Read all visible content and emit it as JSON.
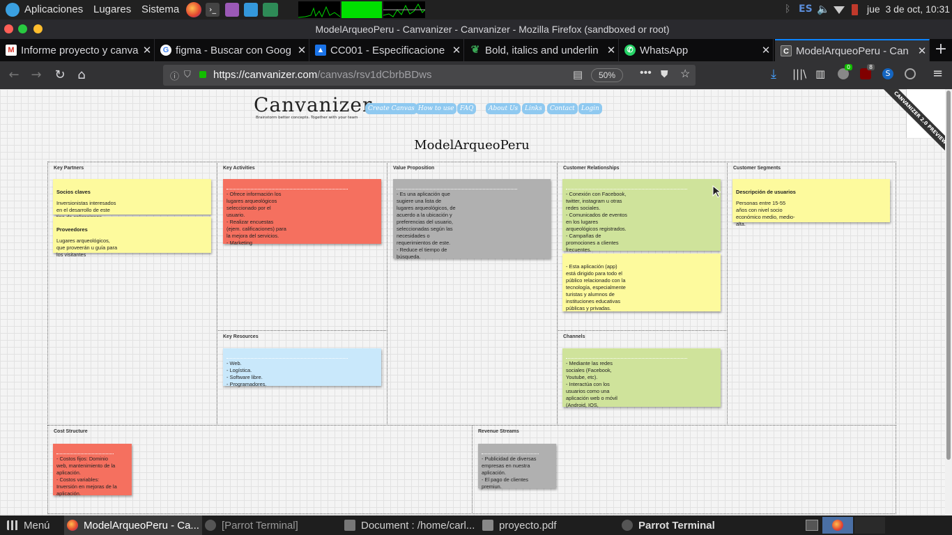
{
  "system_panel": {
    "apps_label": "Aplicaciones",
    "places_label": "Lugares",
    "system_label": "Sistema",
    "keyboard_layout": "ES",
    "datetime": "jue  3 de oct, 10:31"
  },
  "window": {
    "title": "ModelArqueoPeru - Canvanizer - Canvanizer - Mozilla Firefox (sandboxed or root)"
  },
  "tabs": [
    {
      "label": "Informe proyecto y canva",
      "icon": "gmail-icon",
      "color": "#d93025"
    },
    {
      "label": "figma - Buscar con Goog",
      "icon": "google-icon",
      "color": "#4285f4"
    },
    {
      "label": "CC001 - Especificacione",
      "icon": "docs-user-icon",
      "color": "#1a73e8"
    },
    {
      "label": "Bold, italics and underlin",
      "icon": "leaf-icon",
      "color": "#3aa655"
    },
    {
      "label": "WhatsApp",
      "icon": "whatsapp-icon",
      "color": "#25d366"
    },
    {
      "label": "ModelArqueoPeru - Can",
      "icon": "canvanizer-icon",
      "color": "#777777",
      "active": true
    }
  ],
  "navbar": {
    "url_host": "https://canvanizer.com",
    "url_path": "/canvas/rsv1dCbrbBDws",
    "zoom": "50%",
    "ublock_badge": "8",
    "addon_badge": "0"
  },
  "canvanizer": {
    "logo": "Canvanizer",
    "tagline": "Brainstorm better concepts. Together with your team",
    "nav": [
      "Create Canvas",
      "How to use",
      "FAQ",
      "About Us",
      "Links",
      "Contact",
      "Login"
    ],
    "preview_ribbon": "CANVANIZER 2.0 PREVIEW",
    "canvas_title": "ModelArqueoPeru",
    "cells": {
      "key_partners": "Key Partners",
      "key_activities": "Key Activities",
      "value_proposition": "Value Proposition",
      "customer_relationships": "Customer Relationships",
      "customer_segments": "Customer Segments",
      "key_resources": "Key Resources",
      "channels": "Channels",
      "cost_structure": "Cost Structure",
      "revenue_streams": "Revenue Streams"
    },
    "notes": {
      "kp1_title": "Socios claves",
      "kp1_body": "Inversionistas interesados\nen el desarrollo de este\ntipo de aplicaciones.",
      "kp2_title": "Proveedores",
      "kp2_body": "Lugares arqueológicos,\nque proveerán u guía para\nlos visitantes",
      "ka1_body": "- Ofrece información los\nlugares arqueológicos\nseleccionado por el\nusuario.\n- Realizar encuestas\n(ejem. calificaciones) para\nla mejora del servicios.\n- Marketing",
      "vp1_body": "- Es una aplicación que\nsugiere una lista de\nlugares arqueológicos, de\nacuerdo a la ubicación y\npreferencias del usuario,\nseleccionadas según las\nnecesidades o\nrequerimientos de este.\n- Reduce el tiempo de\nbúsqueda.",
      "cr1_body": "- Conexión con Facebook,\ntwitter, instagram u otras\nredes sociales.\n- Comunicados de eventos\nen los lugares\narqueológicos registrados.\n- Campañas de\npromociones a clientes\nfrecuentes.",
      "cr2_body": "- Esta aplicación (app)\nestá dirigido para todo el\npúblico relacionado con la\ntecnología, especialmente\nturistas y alumnos de\ninstituciones educativas\npúblicas y privadas.",
      "cs1_title": "Descripción de usuarios",
      "cs1_body": "Personas entre 15-55\naños con nivel socio\neconómico medio, medio-\nalta.",
      "kr1_body": "- Web.\n- Logística.\n- Software libre.\n- Programadores.",
      "ch1_body": "- Mediante las redes\nsociales (Facebook,\nYoutube, etc).\n- Interactúa con los\nusuarios como una\naplicación web o móvil\n(Android, IOS,",
      "cost1_body": "- Costos fijos: Dominio\nweb, mantenimiento de la\naplicación.\n- Costos variables:\nInversión en mejoras de la\naplicación.",
      "rev1_body": "- Publicidad de diversas\nempresas en nuestra\naplicación.\n- El pago de clientes\npremiun."
    }
  },
  "taskbar": {
    "menu_label": "Menú",
    "items": [
      {
        "label": "ModelArqueoPeru - Ca...",
        "active": true
      },
      {
        "label": "[Parrot Terminal]"
      },
      {
        "label": "Document : /home/carl..."
      },
      {
        "label": "proyecto.pdf"
      },
      {
        "label": "Parrot Terminal",
        "bold": true
      }
    ]
  },
  "colors": {
    "sticky_yellow": "#fdfa9d",
    "sticky_red": "#f5705f",
    "sticky_gray": "#b0b0b0",
    "sticky_green": "#cfe39b",
    "sticky_blue": "#c9e8fb",
    "accent": "#0a84ff"
  }
}
